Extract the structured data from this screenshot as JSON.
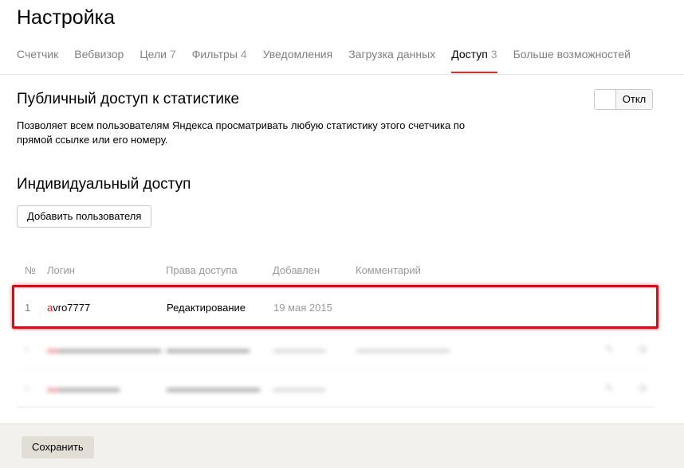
{
  "page": {
    "title": "Настройка"
  },
  "tabs": [
    {
      "label": "Счетчик",
      "count": ""
    },
    {
      "label": "Вебвизор",
      "count": ""
    },
    {
      "label": "Цели",
      "count": "7"
    },
    {
      "label": "Фильтры",
      "count": "4"
    },
    {
      "label": "Уведомления",
      "count": ""
    },
    {
      "label": "Загрузка данных",
      "count": ""
    },
    {
      "label": "Доступ",
      "count": "3",
      "active": true
    },
    {
      "label": "Больше возможностей",
      "count": ""
    }
  ],
  "public_access": {
    "title": "Публичный доступ к статистике",
    "description": "Позволяет всем пользователям Яндекса просматривать любую статистику этого счетчика по прямой ссылке или его номеру.",
    "toggle_label": "Откл",
    "enabled": false
  },
  "individual_access": {
    "title": "Индивидуальный доступ",
    "add_user_label": "Добавить пользователя"
  },
  "table": {
    "headers": {
      "num": "№",
      "login": "Логин",
      "rights": "Права доступа",
      "added": "Добавлен",
      "comment": "Комментарий"
    },
    "rows": [
      {
        "num": "1",
        "login_first": "a",
        "login_rest": "vro7777",
        "rights": "Редактирование",
        "added": "19 мая 2015",
        "comment": ""
      }
    ]
  },
  "footer": {
    "save_label": "Сохранить"
  },
  "colors": {
    "accent": "#e62727",
    "highlight": "#e30613",
    "footer_bg": "#f3f1ed"
  }
}
